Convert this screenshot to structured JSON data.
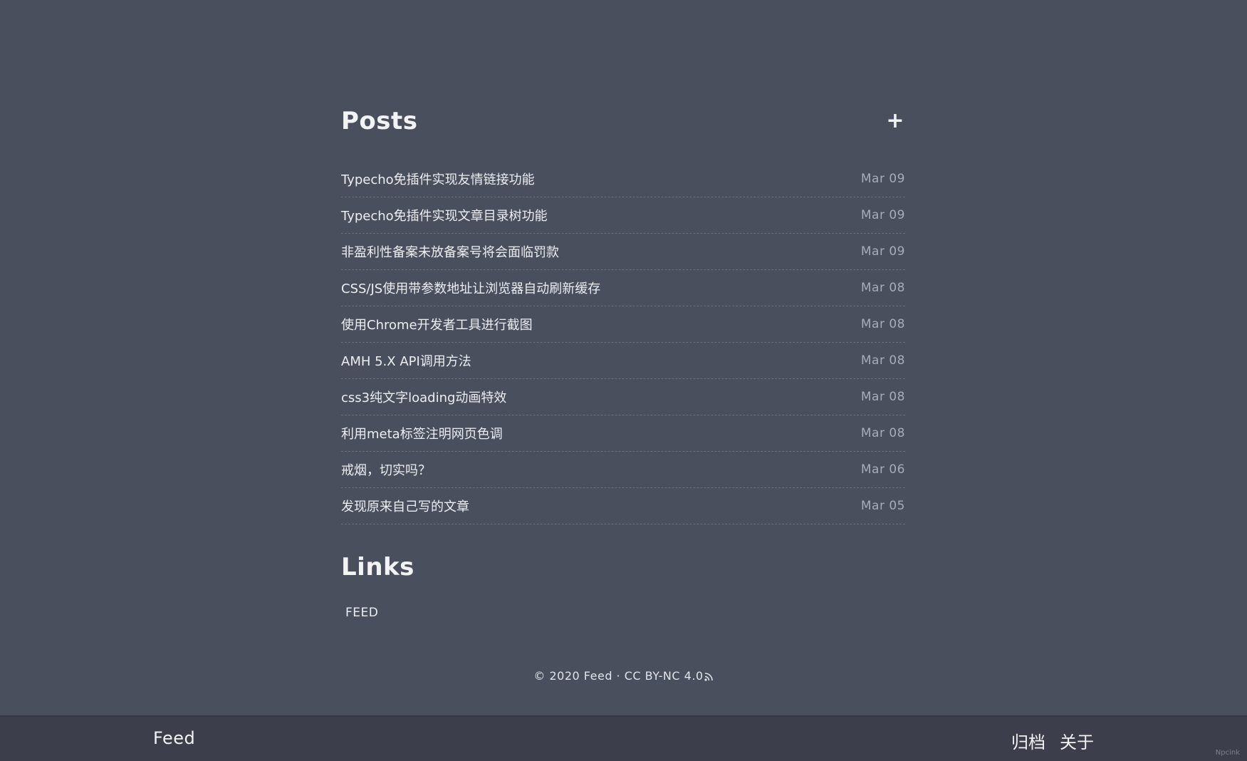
{
  "posts": {
    "heading": "Posts",
    "add_icon": "plus-icon",
    "items": [
      {
        "title": "Typecho免插件实现友情链接功能",
        "date": "Mar 09"
      },
      {
        "title": "Typecho免插件实现文章目录树功能",
        "date": "Mar 09"
      },
      {
        "title": "非盈利性备案未放备案号将会面临罚款",
        "date": "Mar 09"
      },
      {
        "title": "CSS/JS使用带参数地址让浏览器自动刷新缓存",
        "date": "Mar 08"
      },
      {
        "title": "使用Chrome开发者工具进行截图",
        "date": "Mar 08"
      },
      {
        "title": "AMH 5.X API调用方法",
        "date": "Mar 08"
      },
      {
        "title": "css3纯文字loading动画特效",
        "date": "Mar 08"
      },
      {
        "title": "利用meta标签注明网页色调",
        "date": "Mar 08"
      },
      {
        "title": "戒烟，切实吗？",
        "date": "Mar 06"
      },
      {
        "title": "发现原来自己写的文章",
        "date": "Mar 05"
      }
    ]
  },
  "links": {
    "heading": "Links",
    "items": [
      {
        "label": "FEED"
      }
    ]
  },
  "footer": {
    "copyright": "© 2020 Feed · CC BY-NC 4.0",
    "rss_icon": "rss-icon"
  },
  "bottom_bar": {
    "brand": "Feed",
    "nav": [
      {
        "label": "归档"
      },
      {
        "label": "关于"
      }
    ]
  },
  "corner": "Npcink",
  "colors": {
    "background": "#4a4f5e",
    "bar": "#3c3f4b",
    "text": "#eceef2",
    "date": "#a8acb6"
  }
}
